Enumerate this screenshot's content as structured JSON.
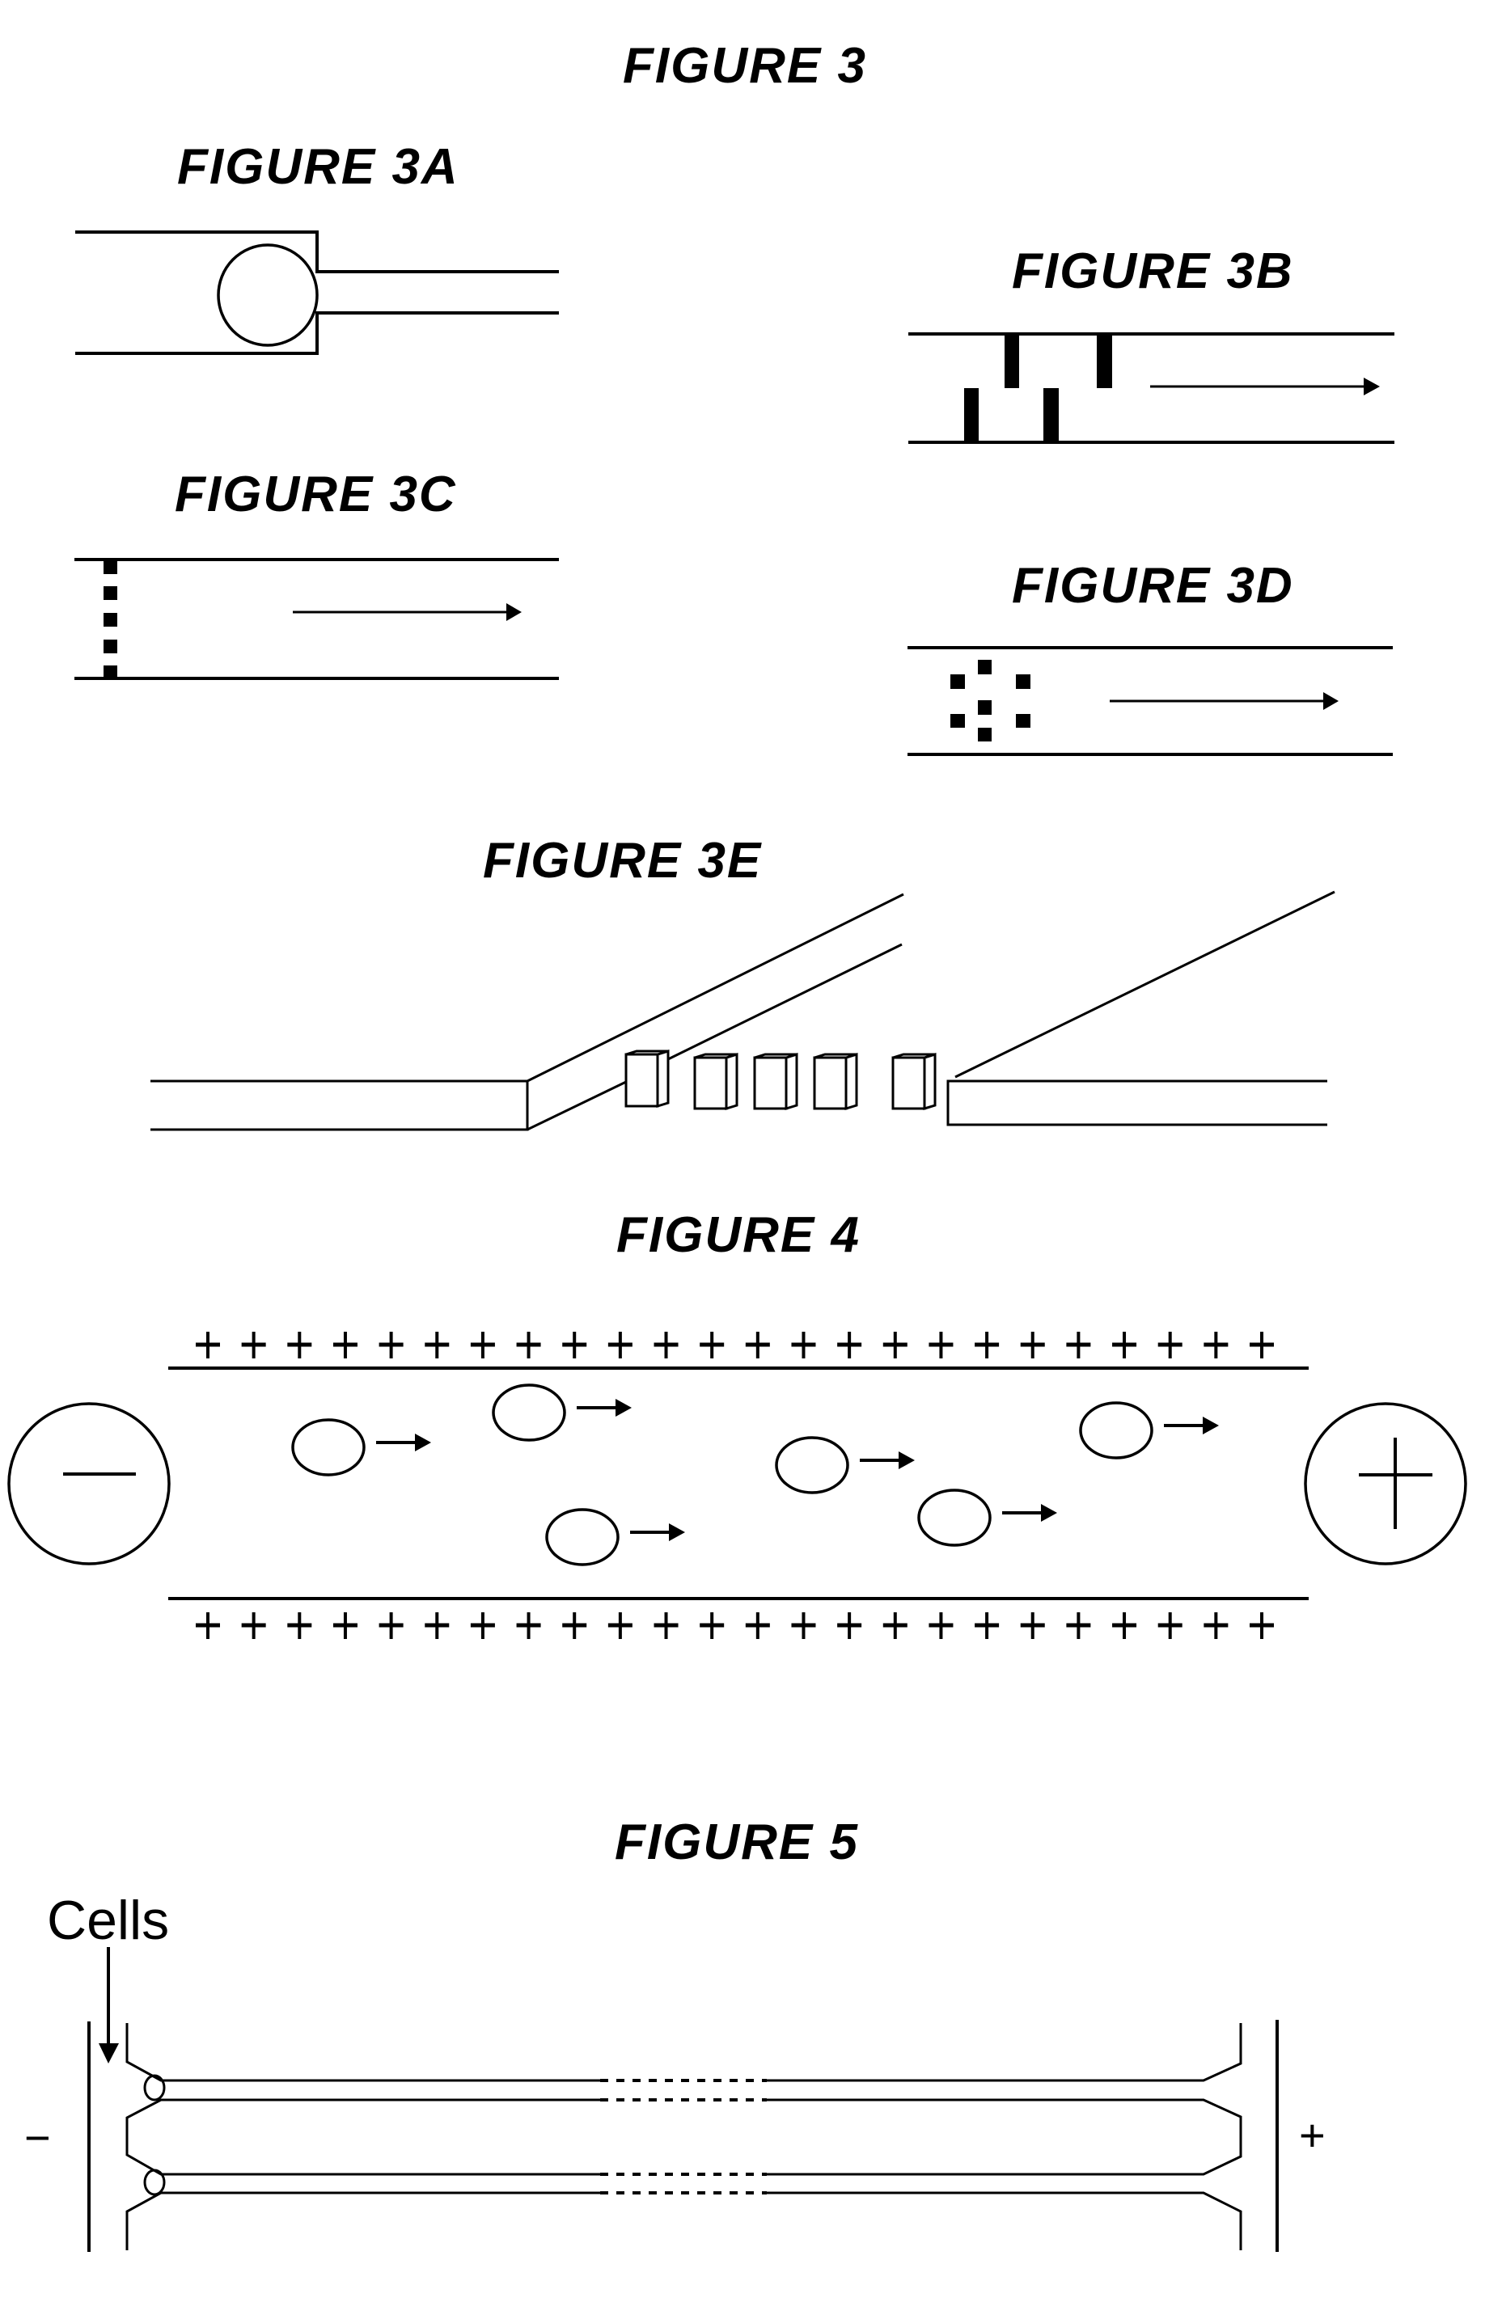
{
  "page": {
    "main_title": "FIGURE 3",
    "figures": {
      "fig3a": {
        "label": "FIGURE 3A"
      },
      "fig3b": {
        "label": "FIGURE 3B"
      },
      "fig3c": {
        "label": "FIGURE 3C"
      },
      "fig3d": {
        "label": "FIGURE 3D"
      },
      "fig3e": {
        "label": "FIGURE 3E",
        "pillar_count": 5
      },
      "fig4": {
        "label": "FIGURE 4",
        "plus_signs_per_row": 24,
        "negative_electrode_symbol": "minus",
        "positive_electrode_symbol": "plus",
        "particle_count": 6,
        "flow_direction": "right"
      },
      "fig5": {
        "label": "FIGURE 5",
        "cells_label": "Cells",
        "left_electrode": "−",
        "right_electrode": "+",
        "channel_count": 2
      }
    }
  }
}
